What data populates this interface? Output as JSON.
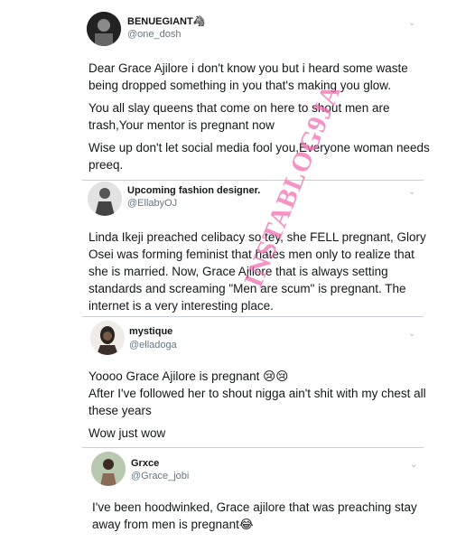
{
  "tweets": [
    {
      "display_name": "BENUEGIANT🦓",
      "handle": "@one_dosh",
      "paragraphs": [
        "Dear Grace Ajilore i don't know you but i heard some waste being dropped something in you that's making you glow.",
        "You all slay queens that come on here to shout men are trash,Your mentor is pregnant now",
        "Wise up don't let social media fool you,Everyone woman needs preeq."
      ]
    },
    {
      "display_name": "Upcoming fashion designer.",
      "handle": "@EllabyOJ",
      "paragraphs": [
        "Linda Ikeji preached celibacy so tey, she FELL pregnant, Glory Osei was forming feminist that hates men only to realize that she is married. Now, Grace Ajilore that is always setting standards and screaming \"Men are scum\" is pregnant. The internet is a very interesting place."
      ]
    },
    {
      "display_name": "mystique",
      "handle": "@elladoga",
      "paragraphs": [
        "Yoooo Grace Ajilore is pregnant 😢😢",
        "After I've followed her to shout nigga ain't shit with my chest all these years",
        "Wow just wow"
      ]
    },
    {
      "display_name": "Grxce",
      "handle": "@Grace_jobi",
      "paragraphs": [
        "I've been hoodwinked, Grace ajilore that was preaching stay away from men is pregnant😂"
      ]
    }
  ],
  "watermark": {
    "text": "INSTABLOG9JA",
    "color": "#f06fb0"
  },
  "icons": {
    "caret": "chevron-down-icon"
  }
}
